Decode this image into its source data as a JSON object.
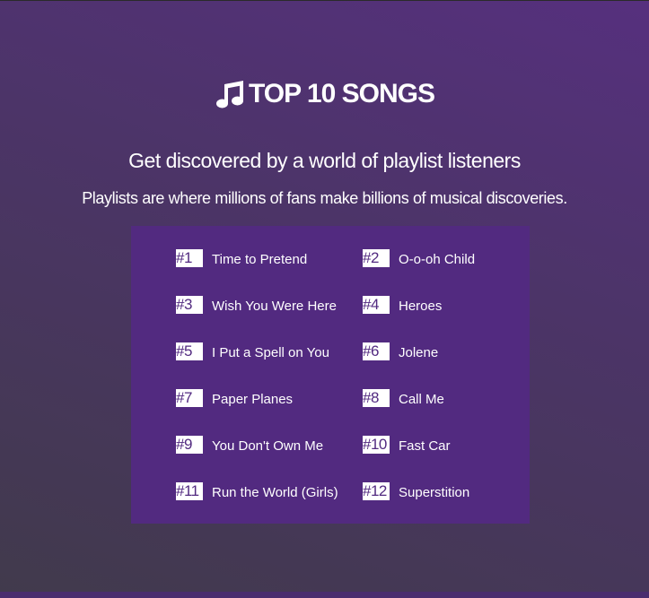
{
  "header": {
    "icon": "music-note-icon",
    "title": "TOP 10 SONGS",
    "subtitle": "Get discovered by a world of playlist listeners",
    "tagline": "Playlists are where millions of fans make billions of musical discoveries."
  },
  "songs": [
    {
      "rank": "#1",
      "title": "Time to Pretend"
    },
    {
      "rank": "#2",
      "title": "O-o-oh Child"
    },
    {
      "rank": "#3",
      "title": "Wish You Were Here"
    },
    {
      "rank": "#4",
      "title": "Heroes"
    },
    {
      "rank": "#5",
      "title": "I Put a Spell on You"
    },
    {
      "rank": "#6",
      "title": "Jolene"
    },
    {
      "rank": "#7",
      "title": "Paper Planes"
    },
    {
      "rank": "#8",
      "title": "Call Me"
    },
    {
      "rank": "#9",
      "title": "You Don't Own Me"
    },
    {
      "rank": "#10",
      "title": "Fast Car"
    },
    {
      "rank": "#11",
      "title": "Run the World (Girls)"
    },
    {
      "rank": "#12",
      "title": "Superstition"
    }
  ],
  "colors": {
    "panel": "#522a80",
    "badge_bg": "#ffffff",
    "badge_text": "#522a80",
    "text": "#ffffff"
  }
}
